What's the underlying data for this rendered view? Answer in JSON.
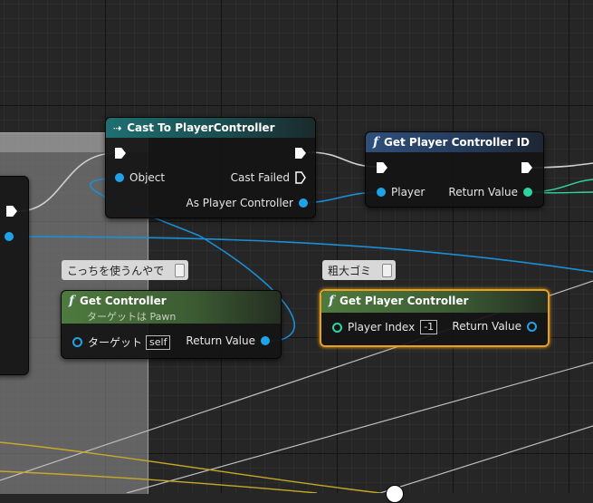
{
  "nodes": {
    "cast": {
      "title": "Cast To PlayerController",
      "object": "Object",
      "cast_failed": "Cast Failed",
      "as_pc": "As Player Controller"
    },
    "get_id": {
      "title": "Get Player Controller ID",
      "player": "Player",
      "return": "Return Value"
    },
    "get_controller": {
      "title": "Get Controller",
      "subtitle": "ターゲットは Pawn",
      "target": "ターゲット",
      "target_value": "self",
      "return": "Return Value"
    },
    "get_pc": {
      "title": "Get Player Controller",
      "player_index": "Player Index",
      "index_value": "-1",
      "return": "Return Value"
    }
  },
  "comments": {
    "c1": "こっちを使うんやで",
    "c2": "粗大ゴミ"
  },
  "colors": {
    "object_pin": "#1fa3e8",
    "int_pin": "#2fd3a0",
    "select": "#e8a020"
  }
}
